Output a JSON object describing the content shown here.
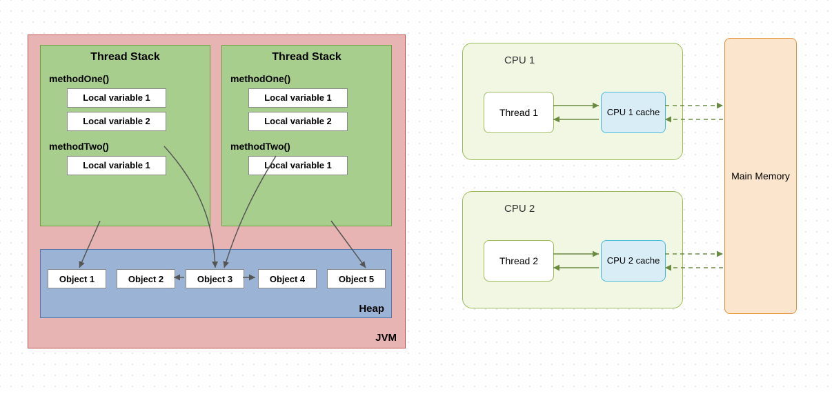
{
  "jvm": {
    "label": "JVM",
    "thread_stacks": [
      {
        "title": "Thread Stack",
        "methods": [
          {
            "name": "methodOne()",
            "locals": [
              "Local variable 1",
              "Local variable 2"
            ]
          },
          {
            "name": "methodTwo()",
            "locals": [
              "Local variable 1"
            ]
          }
        ]
      },
      {
        "title": "Thread Stack",
        "methods": [
          {
            "name": "methodOne()",
            "locals": [
              "Local variable 1",
              "Local variable 2"
            ]
          },
          {
            "name": "methodTwo()",
            "locals": [
              "Local variable 1"
            ]
          }
        ]
      }
    ],
    "heap": {
      "label": "Heap",
      "objects": [
        "Object 1",
        "Object 2",
        "Object 3",
        "Object 4",
        "Object 5"
      ]
    },
    "arrows_desc": "TS1.methodTwo.Local1→Object1; TS1.methodOne.Local2→Object3; TS2.methodOne.Local2→Object3; TS2.methodTwo.Local1→Object5; Object3↔Object2; Object3↔Object4"
  },
  "hardware": {
    "cpus": [
      {
        "title": "CPU 1",
        "thread": "Thread 1",
        "cache": "CPU 1 cache"
      },
      {
        "title": "CPU 2",
        "thread": "Thread 2",
        "cache": "CPU 2 cache"
      }
    ],
    "memory": "Main Memory",
    "arrows_desc": "Thread↔Cache (bidirectional solid); Cache↔MainMemory (bidirectional dashed) per CPU"
  }
}
